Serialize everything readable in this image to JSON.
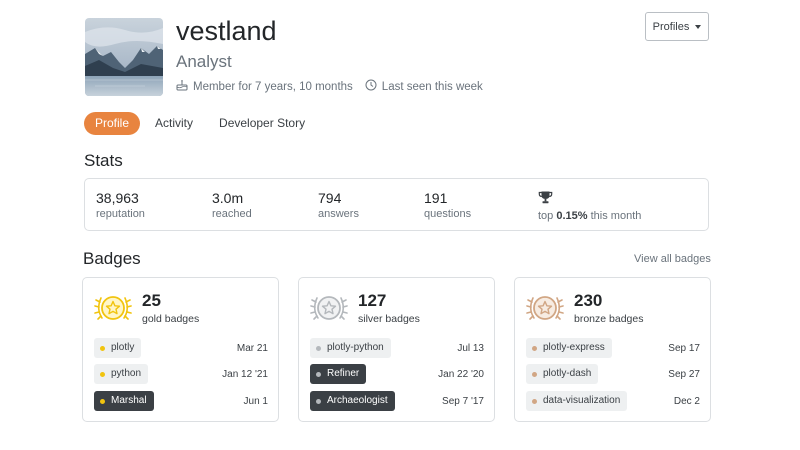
{
  "colors": {
    "accent": "#e8843f",
    "gold": "#f1c40f",
    "silver": "#b4b8bc",
    "bronze": "#d1a684"
  },
  "user": {
    "name": "vestland",
    "title": "Analyst",
    "member_for": "Member for 7 years, 10 months",
    "last_seen": "Last seen this week"
  },
  "header": {
    "profiles_label": "Profiles"
  },
  "tabs": [
    {
      "label": "Profile",
      "active": true
    },
    {
      "label": "Activity",
      "active": false
    },
    {
      "label": "Developer Story",
      "active": false
    }
  ],
  "stats": {
    "title": "Stats",
    "items": [
      {
        "value": "38,963",
        "label": "reputation"
      },
      {
        "value": "3.0m",
        "label": "reached"
      },
      {
        "value": "794",
        "label": "answers"
      },
      {
        "value": "191",
        "label": "questions"
      }
    ],
    "rank": {
      "prefix": "top",
      "value": "0.15%",
      "suffix": "this month",
      "icon": "trophy-icon"
    }
  },
  "badges": {
    "title": "Badges",
    "view_all": "View all badges",
    "cards": [
      {
        "tier": "gold",
        "count": "25",
        "label": "gold badges",
        "items": [
          {
            "name": "plotly",
            "date": "Mar 21",
            "dark": false
          },
          {
            "name": "python",
            "date": "Jan 12 '21",
            "dark": false
          },
          {
            "name": "Marshal",
            "date": "Jun 1",
            "dark": true
          }
        ]
      },
      {
        "tier": "silver",
        "count": "127",
        "label": "silver badges",
        "items": [
          {
            "name": "plotly-python",
            "date": "Jul 13",
            "dark": false
          },
          {
            "name": "Refiner",
            "date": "Jan 22 '20",
            "dark": true
          },
          {
            "name": "Archaeologist",
            "date": "Sep 7 '17",
            "dark": true
          }
        ]
      },
      {
        "tier": "bronze",
        "count": "230",
        "label": "bronze badges",
        "items": [
          {
            "name": "plotly-express",
            "date": "Sep 17",
            "dark": false
          },
          {
            "name": "plotly-dash",
            "date": "Sep 27",
            "dark": false
          },
          {
            "name": "data-visualization",
            "date": "Dec 2",
            "dark": false
          }
        ]
      }
    ]
  }
}
